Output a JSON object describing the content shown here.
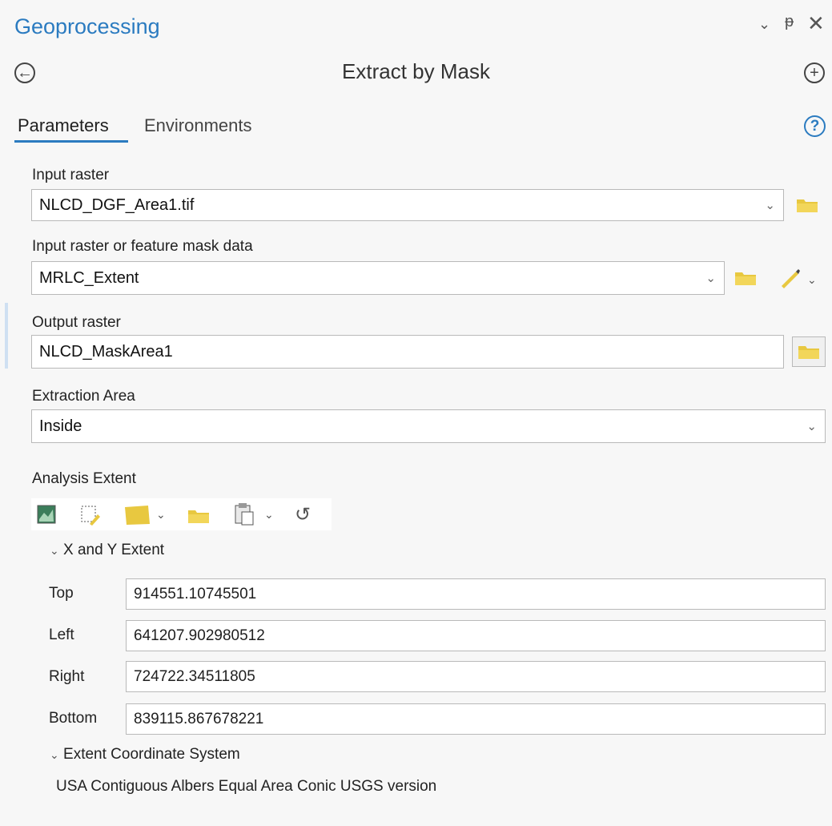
{
  "header": {
    "title": "Geoprocessing",
    "window_controls": [
      "chevron-down-icon",
      "pin-icon",
      "close-icon"
    ]
  },
  "tool": {
    "title": "Extract by Mask",
    "back_icon": "back-arrow-circle-icon",
    "add_icon": "plus-circle-icon"
  },
  "tabs": {
    "parameters": "Parameters",
    "environments": "Environments",
    "active": "Parameters",
    "help_icon": "?"
  },
  "params": {
    "input_raster": {
      "label": "Input raster",
      "value": "NLCD_DGF_Area1.tif"
    },
    "mask": {
      "label": "Input raster or feature mask data",
      "value": "MRLC_Extent"
    },
    "output": {
      "label": "Output raster",
      "value": "NLCD_MaskArea1"
    },
    "extraction_area": {
      "label": "Extraction Area",
      "value": "Inside"
    },
    "analysis_extent": {
      "label": "Analysis Extent",
      "toolbar": [
        "extent-map-icon",
        "draw-extent-icon",
        "layer-extent-icon",
        "browse-folder-icon",
        "paste-extent-icon",
        "reset-icon"
      ]
    },
    "xy_extent": {
      "label": "X and Y Extent",
      "top_label": "Top",
      "top": "914551.10745501",
      "left_label": "Left",
      "left": "641207.902980512",
      "right_label": "Right",
      "right": "724722.34511805",
      "bottom_label": "Bottom",
      "bottom": "839115.867678221"
    },
    "coord_system": {
      "label": "Extent Coordinate System",
      "value": "USA Contiguous Albers Equal Area Conic USGS version"
    }
  },
  "colors": {
    "accent": "#2b7bc0",
    "folder": "#e8c840"
  }
}
